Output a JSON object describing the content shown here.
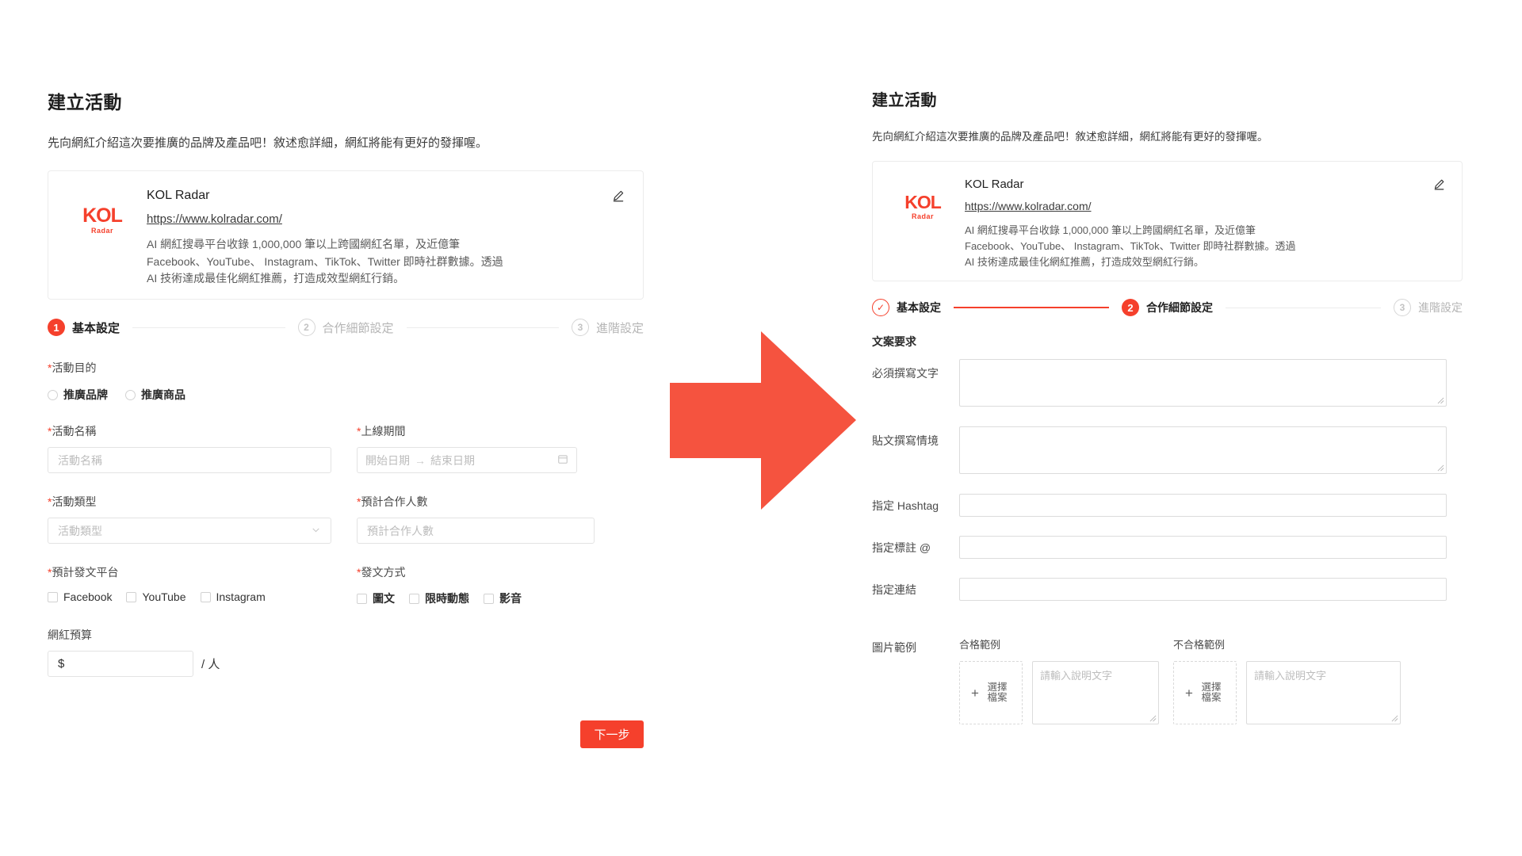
{
  "left_panel": {
    "title": "建立活動",
    "subtitle": "先向網紅介紹這次要推廣的品牌及產品吧！敘述愈詳細，網紅將能有更好的發揮喔。",
    "promo_card": {
      "logo_main": "KOL",
      "logo_sub": "Radar",
      "brand_name": "KOL Radar",
      "url": "https://www.kolradar.com/",
      "description_line1": "AI 網紅搜尋平台收錄 1,000,000 筆以上跨國網紅名單，及近億筆",
      "description_line2": "Facebook、YouTube、 Instagram、TikTok、Twitter 即時社群數據。透過",
      "description_line3": "AI 技術達成最佳化網紅推薦，打造成效型網紅行銷。",
      "edit_icon": "pencil-icon"
    },
    "steps": [
      {
        "num": "1",
        "label": "基本設定",
        "state": "active"
      },
      {
        "num": "2",
        "label": "合作細節設定",
        "state": "idle"
      },
      {
        "num": "3",
        "label": "進階設定",
        "state": "idle"
      }
    ],
    "fields": {
      "purpose_label": "活動目的",
      "purpose_options": [
        "推廣品牌",
        "推廣商品"
      ],
      "name_label": "活動名稱",
      "name_placeholder": "活動名稱",
      "period_label": "上線期間",
      "period_start_placeholder": "開始日期",
      "period_arrow": "→",
      "period_end_placeholder": "結束日期",
      "period_icon": "calendar-icon",
      "type_label": "活動類型",
      "type_placeholder": "活動類型",
      "type_icon": "chevron-down-icon",
      "count_label": "預計合作人數",
      "count_placeholder": "預計合作人數",
      "platform_label": "預計發文平台",
      "platform_options": [
        "Facebook",
        "YouTube",
        "Instagram"
      ],
      "posttype_label": "發文方式",
      "posttype_options": [
        "圖文",
        "限時動態",
        "影音"
      ],
      "budget_label": "網紅預算",
      "budget_value": "$",
      "budget_unit": "/ 人"
    },
    "next_button": "下一步"
  },
  "arrow": {
    "icon": "right-arrow-icon",
    "color": "#f5533f"
  },
  "right_panel": {
    "title": "建立活動",
    "subtitle": "先向網紅介紹這次要推廣的品牌及產品吧！敘述愈詳細，網紅將能有更好的發揮喔。",
    "promo_card": {
      "logo_main": "KOL",
      "logo_sub": "Radar",
      "brand_name": "KOL Radar",
      "url": "https://www.kolradar.com/",
      "description_line1": "AI 網紅搜尋平台收錄 1,000,000 筆以上跨國網紅名單，及近億筆",
      "description_line2": "Facebook、YouTube、 Instagram、TikTok、Twitter 即時社群數據。透過",
      "description_line3": "AI 技術達成最佳化網紅推薦，打造成效型網紅行銷。",
      "edit_icon": "pencil-icon"
    },
    "steps": [
      {
        "num": "✓",
        "label": "基本設定",
        "state": "done"
      },
      {
        "num": "2",
        "label": "合作細節設定",
        "state": "active"
      },
      {
        "num": "3",
        "label": "進階設定",
        "state": "idle"
      }
    ],
    "section_title": "文案要求",
    "fields": {
      "must_write_label": "必須撰寫文字",
      "must_write_value": "",
      "context_label": "貼文撰寫情境",
      "context_value": "",
      "hashtag_label": "指定 Hashtag",
      "hashtag_value": "",
      "mention_label": "指定標註 @",
      "mention_value": "",
      "link_label": "指定連結",
      "link_value": ""
    },
    "image_examples": {
      "label": "圖片範例",
      "good_label": "合格範例",
      "bad_label": "不合格範例",
      "upload_plus": "+",
      "upload_text": "選擇檔案",
      "caption_placeholder": "請輸入說明文字"
    }
  }
}
